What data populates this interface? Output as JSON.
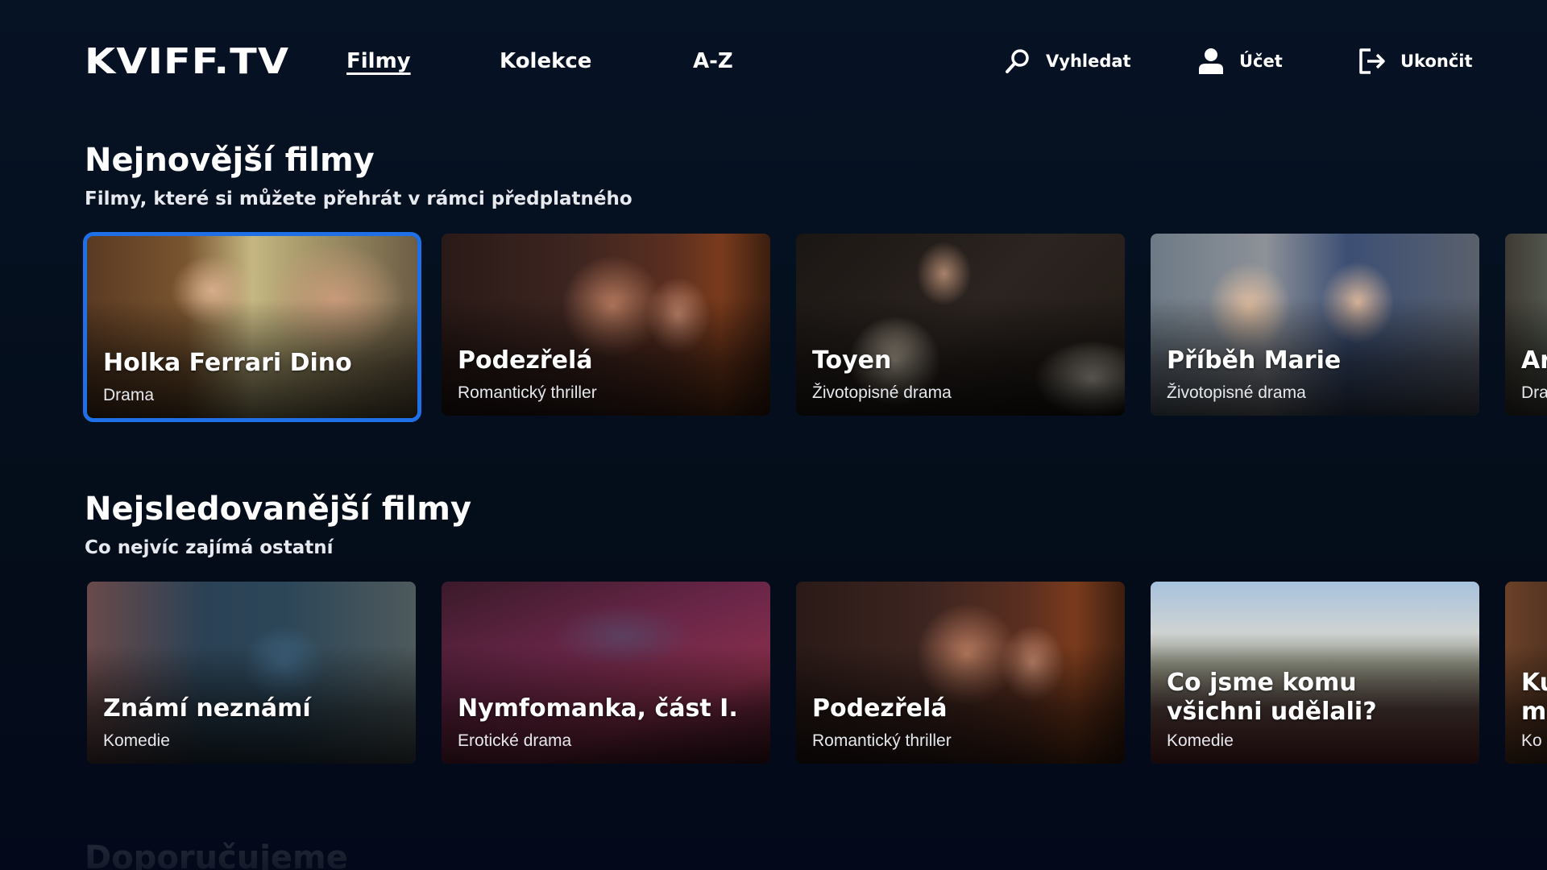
{
  "app": {
    "logo": "KVIFF.TV"
  },
  "nav": {
    "items": [
      {
        "label": "Filmy",
        "active": true
      },
      {
        "label": "Kolekce",
        "active": false
      },
      {
        "label": "A-Z",
        "active": false
      }
    ]
  },
  "actions": {
    "search": {
      "label": "Vyhledat",
      "icon": "search-icon"
    },
    "account": {
      "label": "Účet",
      "icon": "user-icon"
    },
    "logout": {
      "label": "Ukončit",
      "icon": "logout-icon"
    }
  },
  "sections": [
    {
      "title": "Nejnovější filmy",
      "subtitle": "Filmy, které si můžete přehrát v rámci předplatného",
      "cards": [
        {
          "title": "Holka Ferrari Dino",
          "genre": "Drama",
          "focused": true
        },
        {
          "title": "Podezřelá",
          "genre": "Romantický thriller"
        },
        {
          "title": "Toyen",
          "genre": "Životopisné drama"
        },
        {
          "title": "Příběh Marie",
          "genre": "Životopisné drama"
        },
        {
          "title": "Ar",
          "genre": "Dra"
        }
      ]
    },
    {
      "title": "Nejsledovanější filmy",
      "subtitle": "Co nejvíc zajímá ostatní",
      "cards": [
        {
          "title": "Známí neznámí",
          "genre": "Komedie"
        },
        {
          "title": "Nymfomanka, část I.",
          "genre": "Erotické drama"
        },
        {
          "title": "Podezřelá",
          "genre": "Romantický thriller"
        },
        {
          "title": "Co jsme komu všichni udělali?",
          "genre": "Komedie"
        },
        {
          "title": "Ku m",
          "genre": "Ko"
        }
      ]
    },
    {
      "title": "Doporučujeme"
    }
  ],
  "colors": {
    "background": "#050f1e",
    "focus_outline": "#1f6fe6",
    "text": "#ffffff"
  }
}
